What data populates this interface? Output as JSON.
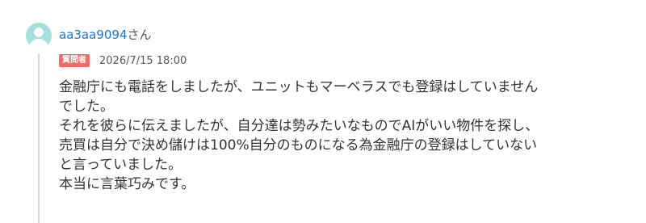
{
  "user": {
    "name": "aa3aa9094",
    "honorific": "さん",
    "avatar_icon": "user-avatar-icon"
  },
  "post": {
    "badge": "質問者",
    "timestamp": "2026/7/15 18:00",
    "lines": [
      "金融庁にも電話をしましたが、ユニットもマーベラスでも登録はしていません",
      "でした。",
      "それを彼らに伝えましたが、自分達は勢みたいなものでAIがいい物件を探し、",
      "売買は自分で決め儲けは100%自分のものになる為金融庁の登録はしていない",
      "と言っていました。",
      "本当に言葉巧みです。"
    ]
  },
  "colors": {
    "username": "#1a73c9",
    "badge_bg": "#f26b6b",
    "avatar_bg": "#a7dfda",
    "thread_line": "#d8d8d8"
  }
}
